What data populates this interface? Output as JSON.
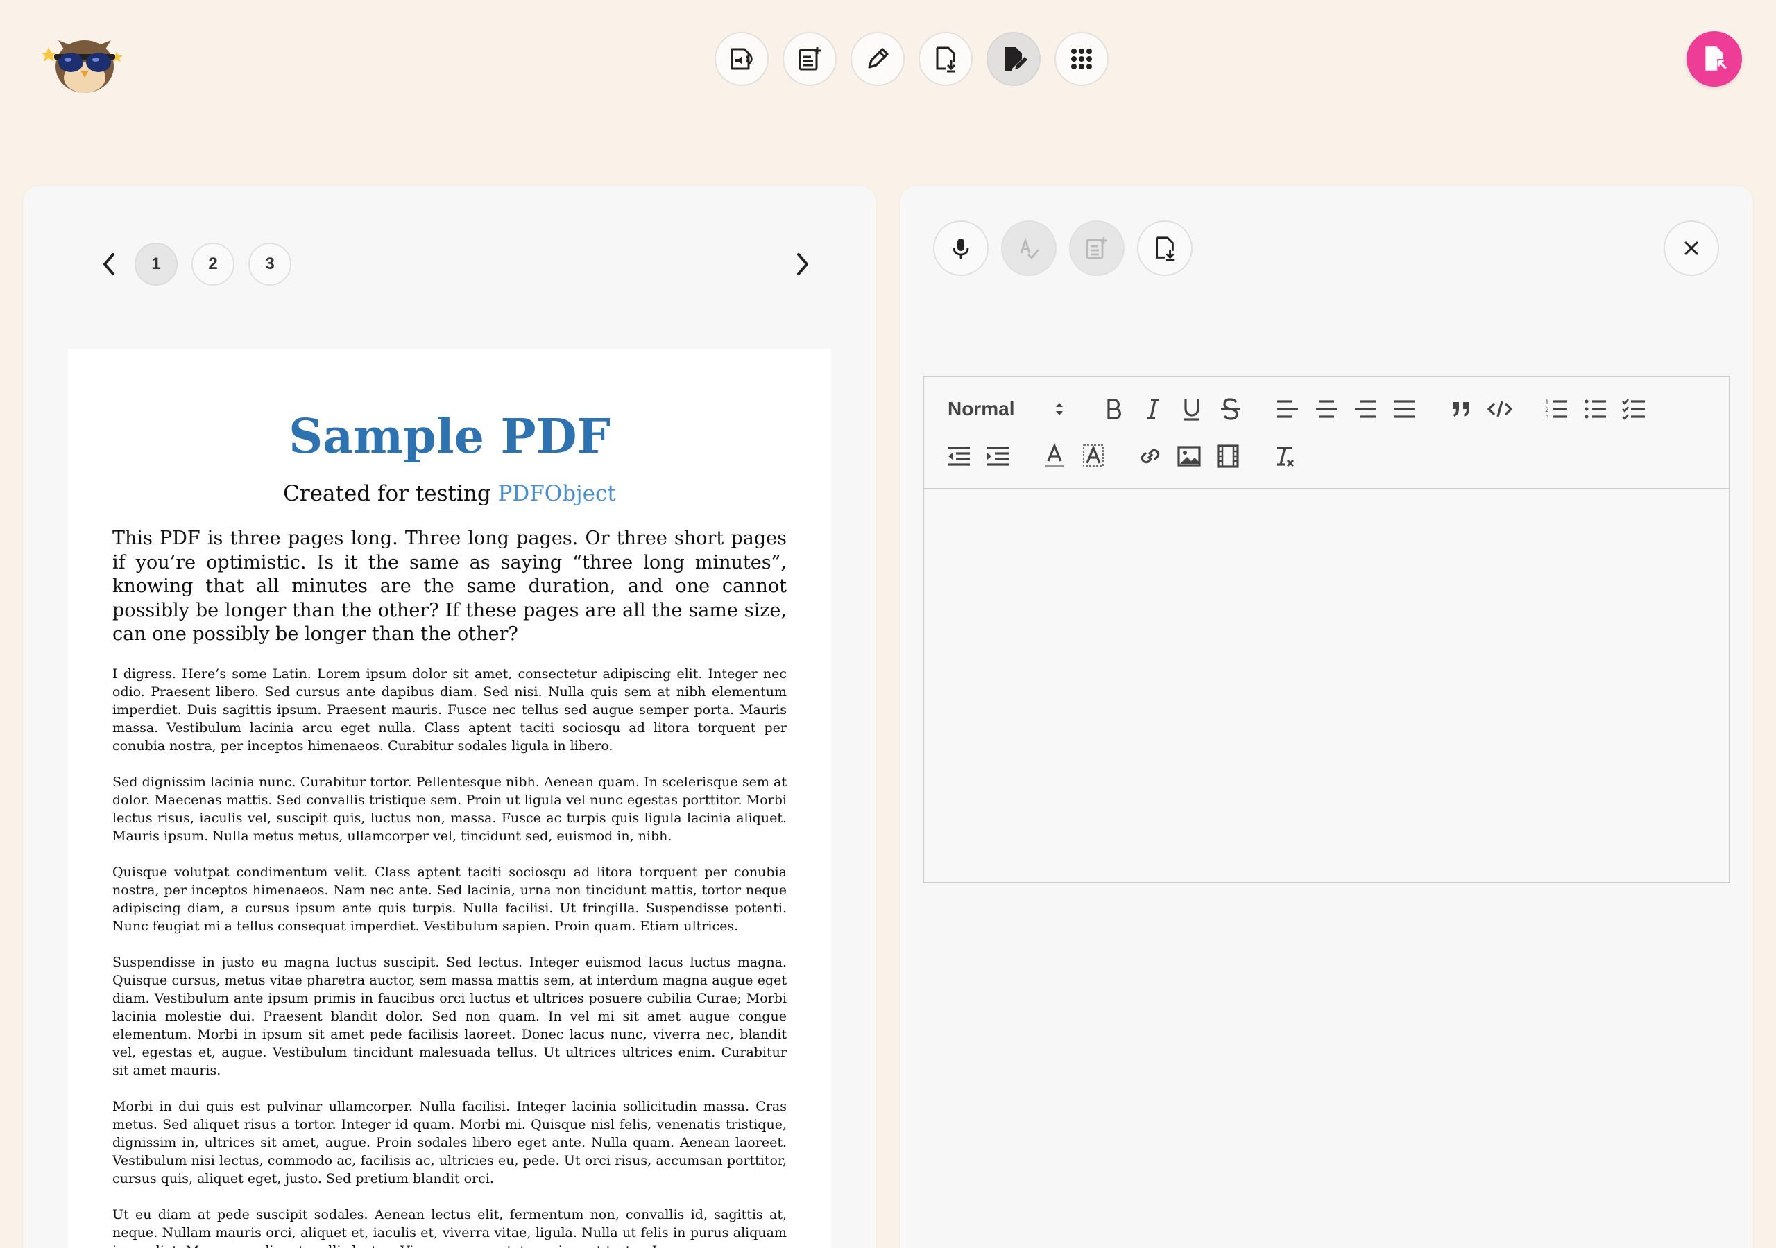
{
  "toolbar": {
    "icons": [
      "read-aloud-icon",
      "new-note-icon",
      "pencil-icon",
      "file-download-icon",
      "file-edit-icon",
      "apps-grid-icon"
    ],
    "active_index": 4
  },
  "pager": {
    "pages": [
      "1",
      "2",
      "3"
    ],
    "current": "1"
  },
  "pdf": {
    "title": "Sample PDF",
    "subtitle_prefix": "Created for testing ",
    "subtitle_link": "PDFObject",
    "lead": "This PDF is three pages long. Three long pages. Or three short pages if you’re optimistic. Is it the same as saying “three long minutes”, knowing that all minutes are the same duration, and one cannot possibly be longer than the other? If these pages are all the same size, can one possibly be longer than the other?",
    "paragraphs": [
      "I digress. Here’s some Latin. Lorem ipsum dolor sit amet, consectetur adipiscing elit. Integer nec odio. Praesent libero. Sed cursus ante dapibus diam. Sed nisi. Nulla quis sem at nibh elementum imperdiet. Duis sagittis ipsum. Praesent mauris. Fusce nec tellus sed augue semper porta. Mauris massa. Vestibulum lacinia arcu eget nulla. Class aptent taciti sociosqu ad litora torquent per conubia nostra, per inceptos himenaeos. Curabitur sodales ligula in libero.",
      "Sed dignissim lacinia nunc. Curabitur tortor. Pellentesque nibh. Aenean quam. In scelerisque sem at dolor. Maecenas mattis. Sed convallis tristique sem. Proin ut ligula vel nunc egestas porttitor. Morbi lectus risus, iaculis vel, suscipit quis, luctus non, massa. Fusce ac turpis quis ligula lacinia aliquet. Mauris ipsum. Nulla metus metus, ullamcorper vel, tincidunt sed, euismod in, nibh.",
      "Quisque volutpat condimentum velit. Class aptent taciti sociosqu ad litora torquent per conubia nostra, per inceptos himenaeos. Nam nec ante. Sed lacinia, urna non tincidunt mattis, tortor neque adipiscing diam, a cursus ipsum ante quis turpis. Nulla facilisi. Ut fringilla. Suspendisse potenti. Nunc feugiat mi a tellus consequat imperdiet. Vestibulum sapien. Proin quam. Etiam ultrices.",
      "Suspendisse in justo eu magna luctus suscipit. Sed lectus. Integer euismod lacus luctus magna. Quisque cursus, metus vitae pharetra auctor, sem massa mattis sem, at interdum magna augue eget diam. Vestibulum ante ipsum primis in faucibus orci luctus et ultrices posuere cubilia Curae; Morbi lacinia molestie dui. Praesent blandit dolor. Sed non quam. In vel mi sit amet augue congue elementum. Morbi in ipsum sit amet pede facilisis laoreet. Donec lacus nunc, viverra nec, blandit vel, egestas et, augue. Vestibulum tincidunt malesuada tellus. Ut ultrices ultrices enim. Curabitur sit amet mauris.",
      "Morbi in dui quis est pulvinar ullamcorper. Nulla facilisi. Integer lacinia sollicitudin massa. Cras metus. Sed aliquet risus a tortor. Integer id quam. Morbi mi. Quisque nisl felis, venenatis tristique, dignissim in, ultrices sit amet, augue. Proin sodales libero eget ante. Nulla quam. Aenean laoreet. Vestibulum nisi lectus, commodo ac, facilisis ac, ultricies eu, pede. Ut orci risus, accumsan porttitor, cursus quis, aliquet eget, justo. Sed pretium blandit orci.",
      "Ut eu diam at pede suscipit sodales. Aenean lectus elit, fermentum non, convallis id, sagittis at, neque. Nullam mauris orci, aliquet et, iaculis et, viverra vitae, ligula. Nulla ut felis in purus aliquam imperdiet. Maecenas aliquet mollis lectus. Vivamus consectetuer risus et tortor. Lorem"
    ]
  },
  "editor": {
    "action_icons": [
      "microphone-icon",
      "spellcheck-icon",
      "new-note-icon",
      "file-download-icon"
    ],
    "disabled_actions": [
      "spellcheck-icon",
      "new-note-icon"
    ],
    "format_select": "Normal",
    "content": ""
  },
  "colors": {
    "background": "#faf1e8",
    "panel": "#f7f7f7",
    "accent_pink": "#ee3d96",
    "pdf_title": "#2f72b0",
    "pdf_link": "#4a8fd0"
  }
}
